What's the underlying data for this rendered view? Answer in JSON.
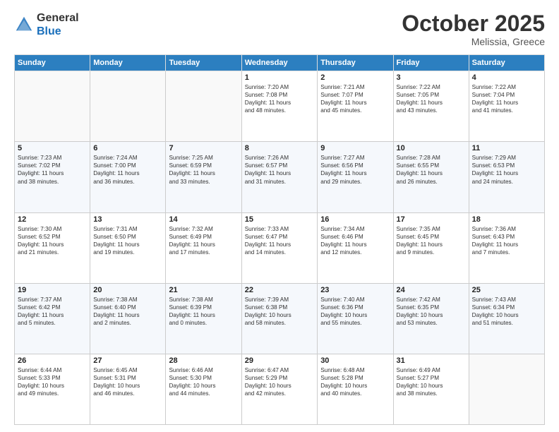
{
  "header": {
    "logo_general": "General",
    "logo_blue": "Blue",
    "month": "October 2025",
    "location": "Melissia, Greece"
  },
  "days_of_week": [
    "Sunday",
    "Monday",
    "Tuesday",
    "Wednesday",
    "Thursday",
    "Friday",
    "Saturday"
  ],
  "weeks": [
    [
      {
        "day": "",
        "info": ""
      },
      {
        "day": "",
        "info": ""
      },
      {
        "day": "",
        "info": ""
      },
      {
        "day": "1",
        "info": "Sunrise: 7:20 AM\nSunset: 7:08 PM\nDaylight: 11 hours\nand 48 minutes."
      },
      {
        "day": "2",
        "info": "Sunrise: 7:21 AM\nSunset: 7:07 PM\nDaylight: 11 hours\nand 45 minutes."
      },
      {
        "day": "3",
        "info": "Sunrise: 7:22 AM\nSunset: 7:05 PM\nDaylight: 11 hours\nand 43 minutes."
      },
      {
        "day": "4",
        "info": "Sunrise: 7:22 AM\nSunset: 7:04 PM\nDaylight: 11 hours\nand 41 minutes."
      }
    ],
    [
      {
        "day": "5",
        "info": "Sunrise: 7:23 AM\nSunset: 7:02 PM\nDaylight: 11 hours\nand 38 minutes."
      },
      {
        "day": "6",
        "info": "Sunrise: 7:24 AM\nSunset: 7:00 PM\nDaylight: 11 hours\nand 36 minutes."
      },
      {
        "day": "7",
        "info": "Sunrise: 7:25 AM\nSunset: 6:59 PM\nDaylight: 11 hours\nand 33 minutes."
      },
      {
        "day": "8",
        "info": "Sunrise: 7:26 AM\nSunset: 6:57 PM\nDaylight: 11 hours\nand 31 minutes."
      },
      {
        "day": "9",
        "info": "Sunrise: 7:27 AM\nSunset: 6:56 PM\nDaylight: 11 hours\nand 29 minutes."
      },
      {
        "day": "10",
        "info": "Sunrise: 7:28 AM\nSunset: 6:55 PM\nDaylight: 11 hours\nand 26 minutes."
      },
      {
        "day": "11",
        "info": "Sunrise: 7:29 AM\nSunset: 6:53 PM\nDaylight: 11 hours\nand 24 minutes."
      }
    ],
    [
      {
        "day": "12",
        "info": "Sunrise: 7:30 AM\nSunset: 6:52 PM\nDaylight: 11 hours\nand 21 minutes."
      },
      {
        "day": "13",
        "info": "Sunrise: 7:31 AM\nSunset: 6:50 PM\nDaylight: 11 hours\nand 19 minutes."
      },
      {
        "day": "14",
        "info": "Sunrise: 7:32 AM\nSunset: 6:49 PM\nDaylight: 11 hours\nand 17 minutes."
      },
      {
        "day": "15",
        "info": "Sunrise: 7:33 AM\nSunset: 6:47 PM\nDaylight: 11 hours\nand 14 minutes."
      },
      {
        "day": "16",
        "info": "Sunrise: 7:34 AM\nSunset: 6:46 PM\nDaylight: 11 hours\nand 12 minutes."
      },
      {
        "day": "17",
        "info": "Sunrise: 7:35 AM\nSunset: 6:45 PM\nDaylight: 11 hours\nand 9 minutes."
      },
      {
        "day": "18",
        "info": "Sunrise: 7:36 AM\nSunset: 6:43 PM\nDaylight: 11 hours\nand 7 minutes."
      }
    ],
    [
      {
        "day": "19",
        "info": "Sunrise: 7:37 AM\nSunset: 6:42 PM\nDaylight: 11 hours\nand 5 minutes."
      },
      {
        "day": "20",
        "info": "Sunrise: 7:38 AM\nSunset: 6:40 PM\nDaylight: 11 hours\nand 2 minutes."
      },
      {
        "day": "21",
        "info": "Sunrise: 7:38 AM\nSunset: 6:39 PM\nDaylight: 11 hours\nand 0 minutes."
      },
      {
        "day": "22",
        "info": "Sunrise: 7:39 AM\nSunset: 6:38 PM\nDaylight: 10 hours\nand 58 minutes."
      },
      {
        "day": "23",
        "info": "Sunrise: 7:40 AM\nSunset: 6:36 PM\nDaylight: 10 hours\nand 55 minutes."
      },
      {
        "day": "24",
        "info": "Sunrise: 7:42 AM\nSunset: 6:35 PM\nDaylight: 10 hours\nand 53 minutes."
      },
      {
        "day": "25",
        "info": "Sunrise: 7:43 AM\nSunset: 6:34 PM\nDaylight: 10 hours\nand 51 minutes."
      }
    ],
    [
      {
        "day": "26",
        "info": "Sunrise: 6:44 AM\nSunset: 5:33 PM\nDaylight: 10 hours\nand 49 minutes."
      },
      {
        "day": "27",
        "info": "Sunrise: 6:45 AM\nSunset: 5:31 PM\nDaylight: 10 hours\nand 46 minutes."
      },
      {
        "day": "28",
        "info": "Sunrise: 6:46 AM\nSunset: 5:30 PM\nDaylight: 10 hours\nand 44 minutes."
      },
      {
        "day": "29",
        "info": "Sunrise: 6:47 AM\nSunset: 5:29 PM\nDaylight: 10 hours\nand 42 minutes."
      },
      {
        "day": "30",
        "info": "Sunrise: 6:48 AM\nSunset: 5:28 PM\nDaylight: 10 hours\nand 40 minutes."
      },
      {
        "day": "31",
        "info": "Sunrise: 6:49 AM\nSunset: 5:27 PM\nDaylight: 10 hours\nand 38 minutes."
      },
      {
        "day": "",
        "info": ""
      }
    ]
  ]
}
